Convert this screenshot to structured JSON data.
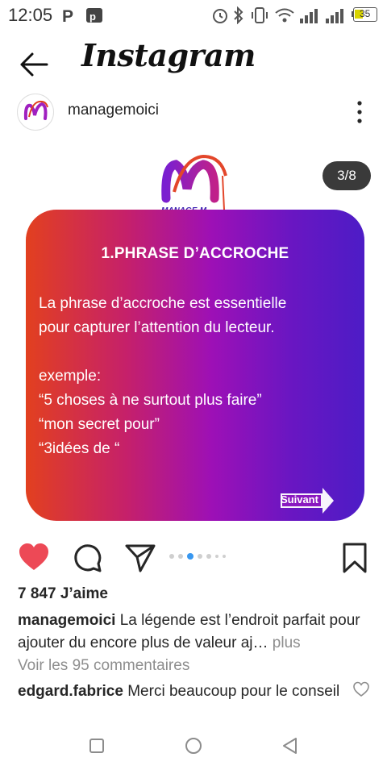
{
  "status_bar": {
    "time": "12:05",
    "battery": "35",
    "icons": [
      "parking-icon",
      "app-icon",
      "alarm-icon",
      "bluetooth-icon",
      "vibrate-icon",
      "wifi-icon",
      "signal-icon",
      "signal-icon",
      "battery-icon"
    ]
  },
  "header": {
    "title": "Instagram",
    "back_icon": "back-arrow-icon"
  },
  "post": {
    "username": "managemoici",
    "counter": "3/8",
    "card": {
      "title": "1.PHRASE D’ACCROCHE",
      "line1": "La phrase d’accroche est essentielle",
      "line2": "pour capturer l’attention du lecteur.",
      "line3": "exemple:",
      "line4": "“5 choses à ne surtout plus faire”",
      "line5": "“mon secret pour”",
      "line6": "“3idées de “",
      "button": "Suivant",
      "gradient": [
        "#e2401f",
        "#9d10b6",
        "#4d1cc6"
      ]
    },
    "logo_text": "MANAGE-M",
    "carousel": {
      "count": 7,
      "active": 2
    },
    "likes": "7 847 J’aime",
    "caption_user": "managemoici",
    "caption_text": " La légende est l’endroit parfait pour ajouter du encore plus de valeur aj…",
    "caption_more": " plus",
    "view_comments": "Voir les 95 commentaires",
    "comment_user": "edgard.fabrice",
    "comment_text": " Merci beaucoup pour le conseil"
  },
  "colors": {
    "like": "#ed4956",
    "text": "#262626",
    "muted": "#8e8e8e"
  }
}
